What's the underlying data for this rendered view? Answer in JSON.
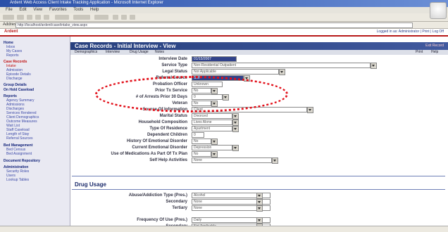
{
  "window": {
    "title": "Ardent Web Access Client Intake Tracking Application - Microsoft Internet Explorer"
  },
  "browser": {
    "menu": [
      "File",
      "Edit",
      "View",
      "Favorites",
      "Tools",
      "Help"
    ],
    "address_label": "Address",
    "address": "http://localhost/ardent/case/intake_view.aspx"
  },
  "app": {
    "brand": "Ardent",
    "header_right": "Logged in as: Administrator | Print | Log Off"
  },
  "sidebar": {
    "sections": [
      {
        "title": "Home",
        "items": [
          "Inbox",
          "My Cases",
          "Reports"
        ]
      },
      {
        "title": "Case Records",
        "items": [
          "Intake",
          "Admission",
          "Episode Details",
          "Discharge"
        ]
      },
      {
        "title": "Group Details",
        "items": []
      },
      {
        "title": "On Hold Caseload",
        "items": []
      },
      {
        "title": "Reports",
        "items": [
          "Agency Summary",
          "Admissions",
          "Discharges",
          "Services Rendered",
          "Client Demographics",
          "Outcome Measures",
          "Wait List",
          "Staff Caseload",
          "Length of Stay",
          "Referral Sources"
        ]
      },
      {
        "title": "Bed Management",
        "items": [
          "Bed Census",
          "Bed Assignment"
        ]
      },
      {
        "title": "Document Repository",
        "items": []
      },
      {
        "title": "Administration",
        "items": [
          "Security Roles",
          "Users",
          "Lookup Tables"
        ]
      }
    ]
  },
  "main": {
    "title": "Case Records - Initial Interview - View",
    "title_right": "Exit Record",
    "subtabs": [
      "Demographics",
      "Interview",
      "Drug Usage",
      "Notes"
    ],
    "subtabs_right": [
      "Print",
      "Help"
    ],
    "fields": [
      {
        "label": "Interview Date",
        "value": "01/15/2007"
      },
      {
        "label": "Service Type",
        "value": "Non-Residential Outpatient"
      },
      {
        "label": "Legal Status",
        "value": "Not Applicable"
      },
      {
        "label": "Referral Source",
        "value": "Self"
      },
      {
        "label": "Probation Officer",
        "value": "Unknown"
      },
      {
        "label": "Prior Tx Service",
        "value": "No"
      },
      {
        "label": "# of Arrests Prior 30 Days",
        "value": "0"
      },
      {
        "label": "Veteran",
        "value": "No"
      },
      {
        "label": "Source Of Information",
        "value": "Client"
      },
      {
        "label": "Marital Status",
        "value": "Divorced"
      },
      {
        "label": "Household Composition",
        "value": "Lives Alone"
      },
      {
        "label": "Type Of Residence",
        "value": "Apartment"
      },
      {
        "label": "Dependent Children",
        "value": "0"
      },
      {
        "label": "History Of Emotional Disorder",
        "value": "No"
      },
      {
        "label": "Current Emotional Disorder",
        "value": "Depression"
      },
      {
        "label": "Use of Medications As Part Of Tx Plan",
        "value": "No"
      },
      {
        "label": "Self Help Activities",
        "value": "None"
      }
    ],
    "drug_section": {
      "title": "Drug Usage",
      "fields": [
        {
          "label": "Abuse/Addiction Type (Pres.)",
          "value": "Alcohol"
        },
        {
          "label": "Secondary",
          "value": "None"
        },
        {
          "label": "Tertiary",
          "value": "None"
        },
        {
          "label": "Frequency Of Use (Pres.)",
          "value": "Daily"
        },
        {
          "label": "Secondary",
          "value": "Not Applicable"
        }
      ]
    }
  },
  "colors": {
    "accent": "#27407e",
    "brand": "#b81a1a",
    "annotation": "#e2101a"
  }
}
